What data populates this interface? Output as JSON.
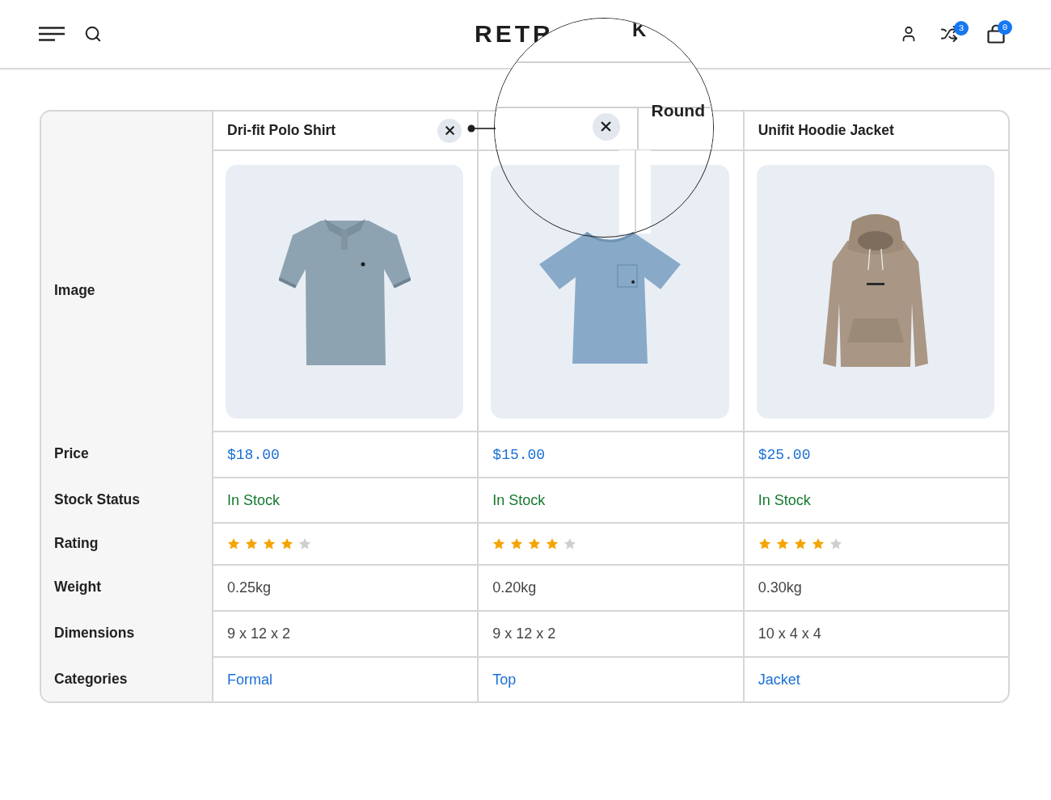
{
  "header": {
    "logo": "RETR",
    "compare_badge": "3",
    "cart_badge": "0"
  },
  "lens": {
    "logo_fragment": "K",
    "remove_button": true,
    "heading": "Round"
  },
  "row_labels": [
    "Image",
    "Price",
    "Stock Status",
    "Rating",
    "Weight",
    "Dimensions",
    "Categories"
  ],
  "products": [
    {
      "name": "Dri-fit Polo Shirt",
      "remove_button": true,
      "image": {
        "kind": "polo",
        "divided": false
      },
      "price": "$18.00",
      "stock": "In Stock",
      "in_stock": true,
      "stars": 4,
      "weight": "0.25kg",
      "dimensions": "9 x 12 x 2",
      "category": "Formal"
    },
    {
      "remove_button": false,
      "image": {
        "kind": "tshirt",
        "divided": true
      },
      "price": "$15.00",
      "stock": "In Stock",
      "in_stock": true,
      "stars": 4,
      "weight": "0.20kg",
      "dimensions": "9 x 12 x 2",
      "category": "Top"
    },
    {
      "name": "Unifit Hoodie Jacket",
      "remove_button": false,
      "image": {
        "kind": "hoodie",
        "divided": false
      },
      "price": "$25.00",
      "stock": "In Stock",
      "in_stock": true,
      "stars": 4,
      "weight": "0.30kg",
      "dimensions": "10 x 4 x 4",
      "category": "Jacket"
    }
  ]
}
